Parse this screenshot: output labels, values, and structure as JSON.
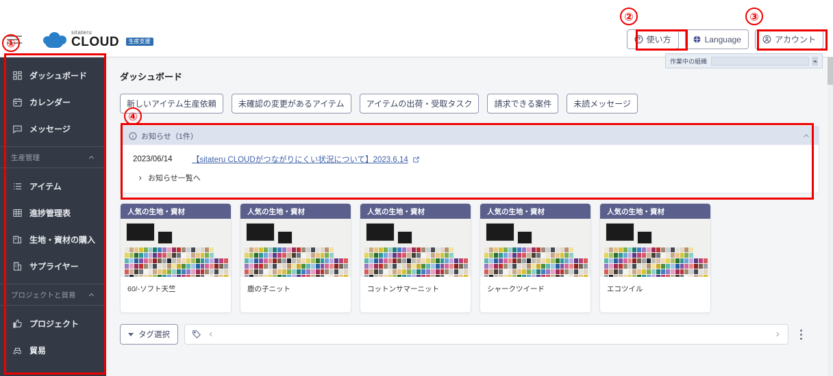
{
  "app": {
    "logo_sub": "sitateru",
    "logo_main": "CLOUD",
    "logo_badge": "生産支援"
  },
  "topbar": {
    "menu_icon": "hamburger-icon",
    "buttons": [
      {
        "label": "使い方",
        "icon": "help-circle-icon"
      },
      {
        "label": "Language",
        "icon": "globe-icon"
      },
      {
        "label": "アカウント",
        "icon": "account-circle-icon"
      }
    ]
  },
  "org_panel": {
    "label": "作業中の組織",
    "value": ""
  },
  "sidebar": {
    "items": [
      {
        "label": "ダッシュボード",
        "icon": "dashboard-grid-icon"
      },
      {
        "label": "カレンダー",
        "icon": "calendar-icon"
      },
      {
        "label": "メッセージ",
        "icon": "message-icon"
      }
    ],
    "sections": [
      {
        "title": "生産管理",
        "chevron": "chevron-up-icon",
        "items": [
          {
            "label": "アイテム",
            "icon": "list-icon"
          },
          {
            "label": "進捗管理表",
            "icon": "table-grid-icon"
          },
          {
            "label": "生地・資材の購入",
            "icon": "fabric-roll-icon"
          },
          {
            "label": "サプライヤー",
            "icon": "building-icon"
          }
        ]
      },
      {
        "title": "プロジェクトと貿易",
        "chevron": "chevron-up-icon",
        "items": [
          {
            "label": "プロジェクト",
            "icon": "thumbs-up-icon"
          },
          {
            "label": "貿易",
            "icon": "ship-icon"
          }
        ]
      }
    ]
  },
  "main": {
    "page_title": "ダッシュボード",
    "filter_buttons": [
      "新しいアイテム生産依頼",
      "未確認の変更があるアイテム",
      "アイテムの出荷・受取タスク",
      "請求できる案件",
      "未読メッセージ"
    ],
    "notice": {
      "icon": "info-circle-icon",
      "title": "お知らせ（1件）",
      "collapse_icon": "chevron-up-icon",
      "entries": [
        {
          "date": "2023/06/14",
          "link_text": "【sitateru CLOUDがつながりにくい状況について】2023.6.14",
          "external_icon": "external-link-icon"
        }
      ],
      "more_label": "お知らせ一覧へ",
      "more_icon": "chevron-right-icon"
    },
    "cards": [
      {
        "header": "人気の生地・資材",
        "name": "60/-ソフト天竺"
      },
      {
        "header": "人気の生地・資材",
        "name": "鹿の子ニット"
      },
      {
        "header": "人気の生地・資材",
        "name": "コットンサマーニット"
      },
      {
        "header": "人気の生地・資材",
        "name": "シャークツイード"
      },
      {
        "header": "人気の生地・資材",
        "name": "エコツイル"
      }
    ],
    "tagbar": {
      "select_label": "タグ選択",
      "caret_icon": "caret-down-icon",
      "tag_icon": "tag-icon",
      "prev_icon": "chevron-left-icon",
      "next_icon": "chevron-right-icon",
      "more_icon": "vertical-dots-icon",
      "field_value": ""
    }
  },
  "annotations": [
    {
      "number": "①"
    },
    {
      "number": "②"
    },
    {
      "number": "③"
    },
    {
      "number": "④"
    }
  ],
  "colors": {
    "sidebar_bg": "#333a45",
    "accent": "#5b5f8c",
    "annotation_red": "#ee0000",
    "link_blue": "#3e5fa8",
    "notice_head": "#dde3ee"
  }
}
